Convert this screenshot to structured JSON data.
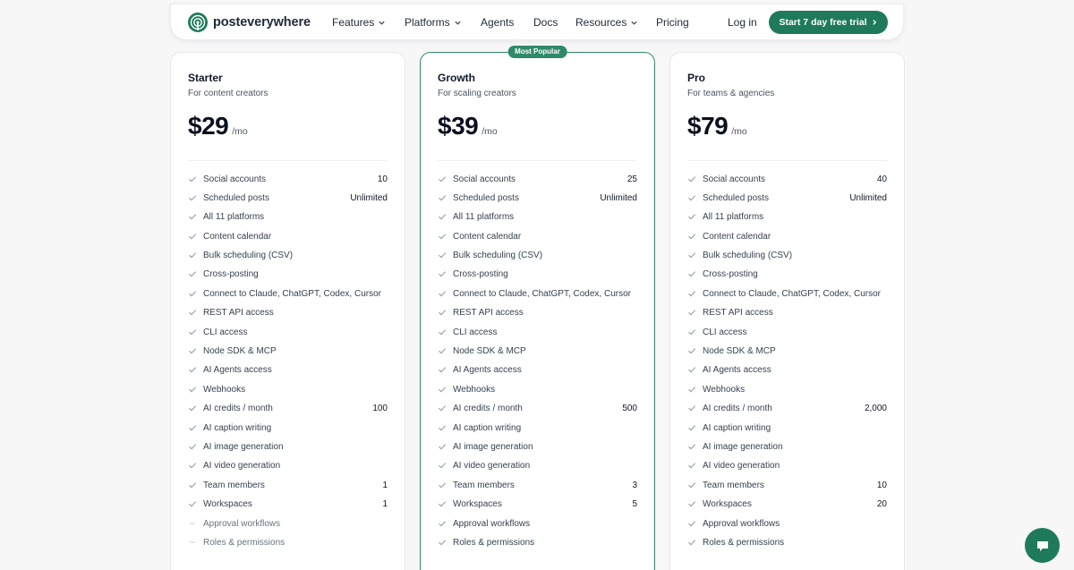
{
  "nav": {
    "brand": "posteverywhere",
    "items": [
      {
        "label": "Features",
        "dropdown": true
      },
      {
        "label": "Platforms",
        "dropdown": true
      },
      {
        "label": "Agents",
        "dropdown": false
      },
      {
        "label": "Docs",
        "dropdown": false
      },
      {
        "label": "Resources",
        "dropdown": true
      },
      {
        "label": "Pricing",
        "dropdown": false
      }
    ],
    "login": "Log in",
    "cta": "Start 7 day free trial"
  },
  "colors": {
    "brand_green": "#1f7a5b",
    "check": "#9ca3af"
  },
  "plans": [
    {
      "name": "Starter",
      "desc": "For content creators",
      "price": "$29",
      "per": "/mo",
      "badge": "",
      "features": [
        {
          "label": "Social accounts",
          "value": "10",
          "included": true
        },
        {
          "label": "Scheduled posts",
          "value": "Unlimited",
          "included": true
        },
        {
          "label": "All 11 platforms",
          "value": "",
          "included": true
        },
        {
          "label": "Content calendar",
          "value": "",
          "included": true
        },
        {
          "label": "Bulk scheduling (CSV)",
          "value": "",
          "included": true
        },
        {
          "label": "Cross-posting",
          "value": "",
          "included": true
        },
        {
          "label": "Connect to Claude, ChatGPT, Codex, Cursor",
          "value": "",
          "included": true
        },
        {
          "label": "REST API access",
          "value": "",
          "included": true
        },
        {
          "label": "CLI access",
          "value": "",
          "included": true
        },
        {
          "label": "Node SDK & MCP",
          "value": "",
          "included": true
        },
        {
          "label": "AI Agents access",
          "value": "",
          "included": true
        },
        {
          "label": "Webhooks",
          "value": "",
          "included": true
        },
        {
          "label": "AI credits / month",
          "value": "100",
          "included": true
        },
        {
          "label": "AI caption writing",
          "value": "",
          "included": true
        },
        {
          "label": "AI image generation",
          "value": "",
          "included": true
        },
        {
          "label": "AI video generation",
          "value": "",
          "included": true
        },
        {
          "label": "Team members",
          "value": "1",
          "included": true
        },
        {
          "label": "Workspaces",
          "value": "1",
          "included": true
        },
        {
          "label": "Approval workflows",
          "value": "",
          "included": false
        },
        {
          "label": "Roles & permissions",
          "value": "",
          "included": false
        }
      ]
    },
    {
      "name": "Growth",
      "desc": "For scaling creators",
      "price": "$39",
      "per": "/mo",
      "badge": "Most Popular",
      "features": [
        {
          "label": "Social accounts",
          "value": "25",
          "included": true
        },
        {
          "label": "Scheduled posts",
          "value": "Unlimited",
          "included": true
        },
        {
          "label": "All 11 platforms",
          "value": "",
          "included": true
        },
        {
          "label": "Content calendar",
          "value": "",
          "included": true
        },
        {
          "label": "Bulk scheduling (CSV)",
          "value": "",
          "included": true
        },
        {
          "label": "Cross-posting",
          "value": "",
          "included": true
        },
        {
          "label": "Connect to Claude, ChatGPT, Codex, Cursor",
          "value": "",
          "included": true
        },
        {
          "label": "REST API access",
          "value": "",
          "included": true
        },
        {
          "label": "CLI access",
          "value": "",
          "included": true
        },
        {
          "label": "Node SDK & MCP",
          "value": "",
          "included": true
        },
        {
          "label": "AI Agents access",
          "value": "",
          "included": true
        },
        {
          "label": "Webhooks",
          "value": "",
          "included": true
        },
        {
          "label": "AI credits / month",
          "value": "500",
          "included": true
        },
        {
          "label": "AI caption writing",
          "value": "",
          "included": true
        },
        {
          "label": "AI image generation",
          "value": "",
          "included": true
        },
        {
          "label": "AI video generation",
          "value": "",
          "included": true
        },
        {
          "label": "Team members",
          "value": "3",
          "included": true
        },
        {
          "label": "Workspaces",
          "value": "5",
          "included": true
        },
        {
          "label": "Approval workflows",
          "value": "",
          "included": true
        },
        {
          "label": "Roles & permissions",
          "value": "",
          "included": true
        }
      ]
    },
    {
      "name": "Pro",
      "desc": "For teams & agencies",
      "price": "$79",
      "per": "/mo",
      "badge": "",
      "features": [
        {
          "label": "Social accounts",
          "value": "40",
          "included": true
        },
        {
          "label": "Scheduled posts",
          "value": "Unlimited",
          "included": true
        },
        {
          "label": "All 11 platforms",
          "value": "",
          "included": true
        },
        {
          "label": "Content calendar",
          "value": "",
          "included": true
        },
        {
          "label": "Bulk scheduling (CSV)",
          "value": "",
          "included": true
        },
        {
          "label": "Cross-posting",
          "value": "",
          "included": true
        },
        {
          "label": "Connect to Claude, ChatGPT, Codex, Cursor",
          "value": "",
          "included": true
        },
        {
          "label": "REST API access",
          "value": "",
          "included": true
        },
        {
          "label": "CLI access",
          "value": "",
          "included": true
        },
        {
          "label": "Node SDK & MCP",
          "value": "",
          "included": true
        },
        {
          "label": "AI Agents access",
          "value": "",
          "included": true
        },
        {
          "label": "Webhooks",
          "value": "",
          "included": true
        },
        {
          "label": "AI credits / month",
          "value": "2,000",
          "included": true
        },
        {
          "label": "AI caption writing",
          "value": "",
          "included": true
        },
        {
          "label": "AI image generation",
          "value": "",
          "included": true
        },
        {
          "label": "AI video generation",
          "value": "",
          "included": true
        },
        {
          "label": "Team members",
          "value": "10",
          "included": true
        },
        {
          "label": "Workspaces",
          "value": "20",
          "included": true
        },
        {
          "label": "Approval workflows",
          "value": "",
          "included": true
        },
        {
          "label": "Roles & permissions",
          "value": "",
          "included": true
        }
      ]
    }
  ]
}
